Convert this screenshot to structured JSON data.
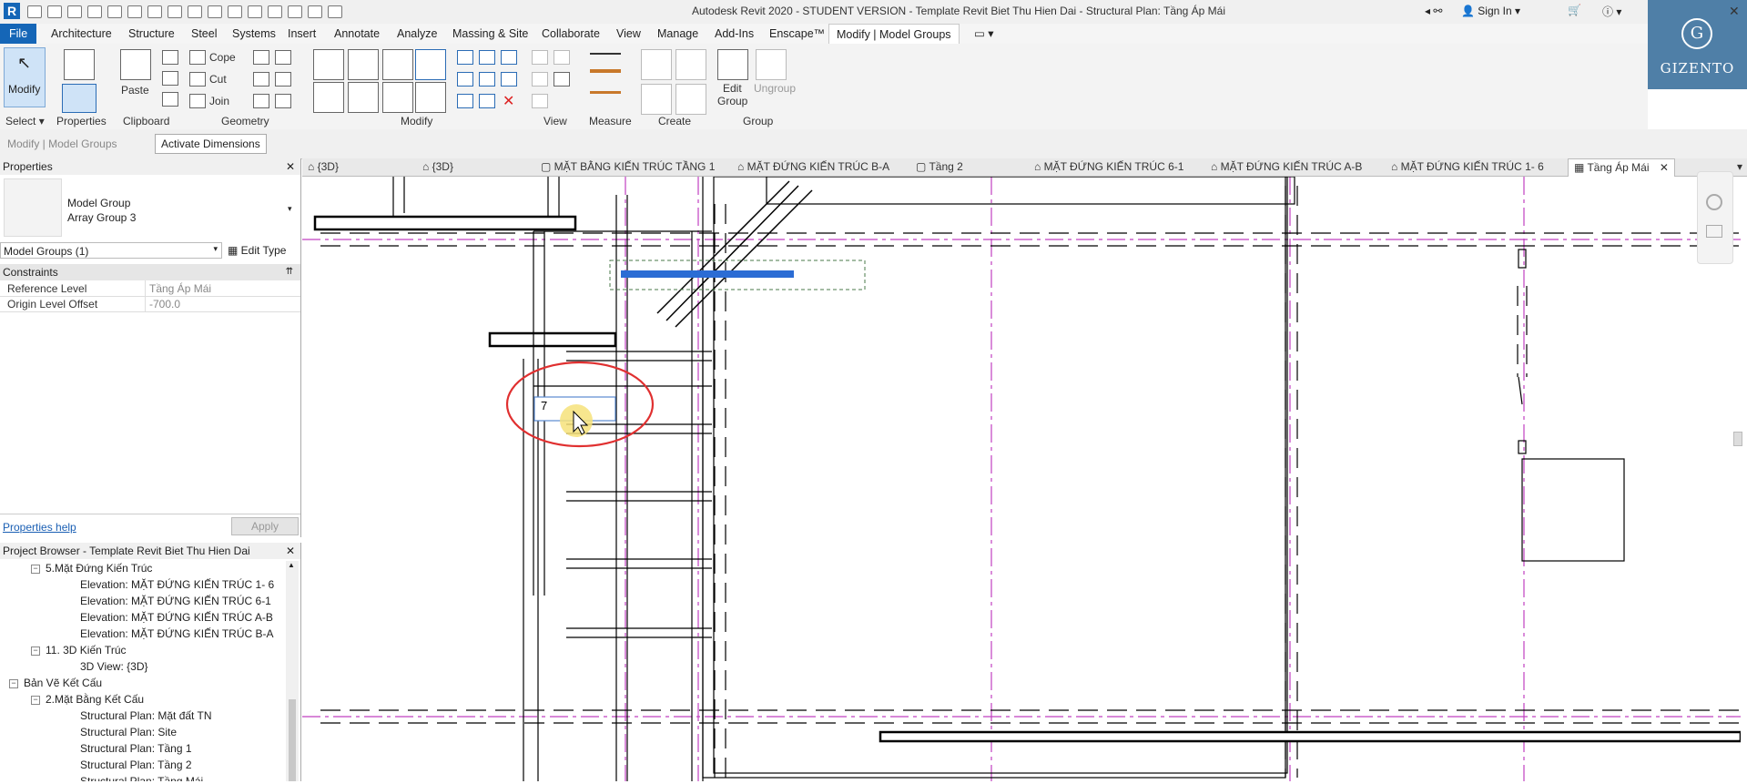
{
  "app": {
    "title": "Autodesk Revit 2020 - STUDENT VERSION - Template Revit Biet Thu Hien Dai - Structural Plan: Tầng Áp Mái",
    "sign_in": "Sign In"
  },
  "menu": [
    "File",
    "Architecture",
    "Structure",
    "Steel",
    "Systems",
    "Insert",
    "Annotate",
    "Analyze",
    "Massing & Site",
    "Collaborate",
    "View",
    "Manage",
    "Add-Ins",
    "Enscape™",
    "Modify | Model Groups"
  ],
  "ribbon": {
    "modify": "Modify",
    "select": "Select",
    "properties": "Properties",
    "paste": "Paste",
    "clipboard": "Clipboard",
    "cope": "Cope",
    "cut": "Cut",
    "join": "Join",
    "geometry": "Geometry",
    "modify_panel": "Modify",
    "view": "View",
    "measure": "Measure",
    "create": "Create",
    "edit_group_1": "Edit",
    "edit_group_2": "Group",
    "ungroup": "Ungroup",
    "group": "Group"
  },
  "options": {
    "context": "Modify | Model Groups",
    "activate": "Activate Dimensions"
  },
  "logo": {
    "text": "GIZENTO",
    "mark": "G"
  },
  "view_tabs": [
    "{3D}",
    "{3D}",
    "MẶT BẰNG KIẾN TRÚC TẦNG 1",
    "MẶT ĐỨNG KIẾN TRÚC B-A",
    "Tầng 2",
    "MẶT ĐỨNG KIẾN TRÚC 6-1",
    "MẶT ĐỨNG KIẾN TRÚC A-B",
    "MẶT ĐỨNG KIẾN TRÚC 1- 6",
    "Tầng Áp Mái"
  ],
  "properties": {
    "header": "Properties",
    "type_name": "Model Group",
    "type_sub": "Array Group 3",
    "selector": "Model Groups (1)",
    "edit_type": "Edit Type",
    "section": "Constraints",
    "rows": [
      {
        "label": "Reference Level",
        "value": "Tầng Áp Mái"
      },
      {
        "label": "Origin Level Offset",
        "value": "-700.0"
      }
    ],
    "help": "Properties help",
    "apply": "Apply"
  },
  "browser": {
    "header": "Project Browser - Template Revit Biet Thu Hien Dai",
    "items": [
      {
        "text": "5.Mặt Đứng Kiến Trúc",
        "level": 2,
        "toggle": "−"
      },
      {
        "text": "Elevation: MẶT ĐỨNG KIẾN TRÚC 1- 6",
        "level": 3,
        "toggle": ""
      },
      {
        "text": "Elevation: MẶT ĐỨNG KIẾN TRÚC 6-1",
        "level": 3,
        "toggle": ""
      },
      {
        "text": "Elevation: MẶT ĐỨNG KIẾN TRÚC A-B",
        "level": 3,
        "toggle": ""
      },
      {
        "text": "Elevation: MẶT ĐỨNG KIẾN TRÚC B-A",
        "level": 3,
        "toggle": ""
      },
      {
        "text": "11. 3D Kiến Trúc",
        "level": 2,
        "toggle": "−"
      },
      {
        "text": "3D View: {3D}",
        "level": 3,
        "toggle": ""
      },
      {
        "text": "Bản Vẽ Kết Cấu",
        "level": 1,
        "toggle": "−"
      },
      {
        "text": "2.Mặt Bằng Kết Cấu",
        "level": 2,
        "toggle": "−"
      },
      {
        "text": "Structural Plan: Mặt đất TN",
        "level": 3,
        "toggle": ""
      },
      {
        "text": "Structural Plan: Site",
        "level": 3,
        "toggle": ""
      },
      {
        "text": "Structural Plan: Tầng 1",
        "level": 3,
        "toggle": ""
      },
      {
        "text": "Structural Plan: Tầng 2",
        "level": 3,
        "toggle": ""
      },
      {
        "text": "Structural Plan: Tầng Mái",
        "level": 3,
        "toggle": ""
      }
    ]
  },
  "canvas": {
    "input_value": "7"
  },
  "colors": {
    "accent": "#1566b7",
    "grid": "#c040c0",
    "highlight": "#2b6cd4",
    "annotation": "#e03030"
  }
}
